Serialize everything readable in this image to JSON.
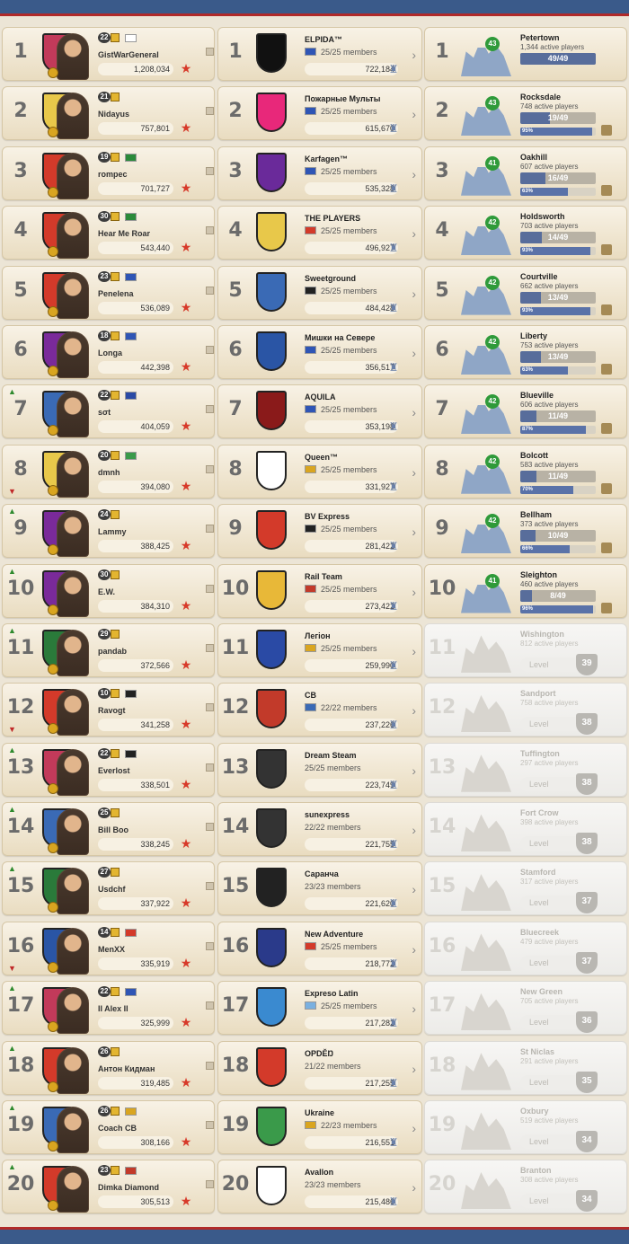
{
  "players": [
    {
      "rank": "1",
      "trend": "",
      "level": "22",
      "flag": "#ffffff",
      "name": "GistWarGeneral",
      "score": "1,208,034",
      "shield": "#c23a5a"
    },
    {
      "rank": "2",
      "trend": "",
      "level": "21",
      "flag": "",
      "name": "Nidayus",
      "score": "757,801",
      "shield": "#e8c84a"
    },
    {
      "rank": "3",
      "trend": "",
      "level": "19",
      "flag": "#2a8a3a",
      "name": "rompec",
      "score": "701,727",
      "shield": "#d33a2a"
    },
    {
      "rank": "4",
      "trend": "",
      "level": "30",
      "flag": "#2a8a3a",
      "name": "Hear Me Roar",
      "score": "543,440",
      "shield": "#d33a2a"
    },
    {
      "rank": "5",
      "trend": "",
      "level": "23",
      "flag": "#2f55b5",
      "name": "Penelena",
      "score": "536,089",
      "shield": "#d33a2a"
    },
    {
      "rank": "6",
      "trend": "",
      "level": "18",
      "flag": "#2f55b5",
      "name": "Longa",
      "score": "442,398",
      "shield": "#7a2a9a"
    },
    {
      "rank": "7",
      "trend": "up",
      "level": "22",
      "flag": "#2a4aa5",
      "name": "sσt",
      "score": "404,059",
      "shield": "#3a6ab5"
    },
    {
      "rank": "8",
      "trend": "down",
      "level": "20",
      "flag": "#3a9a4a",
      "name": "dmnh",
      "score": "394,080",
      "shield": "#e8c84a"
    },
    {
      "rank": "9",
      "trend": "up",
      "level": "24",
      "flag": "",
      "name": "Lammy",
      "score": "388,425",
      "shield": "#7a2a9a"
    },
    {
      "rank": "10",
      "trend": "up",
      "level": "30",
      "flag": "",
      "name": "E.W.",
      "score": "384,310",
      "shield": "#7a2a9a"
    },
    {
      "rank": "11",
      "trend": "up",
      "level": "29",
      "flag": "",
      "name": "pandab",
      "score": "372,566",
      "shield": "#2a7a3a"
    },
    {
      "rank": "12",
      "trend": "down",
      "level": "10",
      "flag": "#222222",
      "name": "Ravogt",
      "score": "341,258",
      "shield": "#d33a2a"
    },
    {
      "rank": "13",
      "trend": "up",
      "level": "22",
      "flag": "#222222",
      "name": "Everlost",
      "score": "338,501",
      "shield": "#c23a5a"
    },
    {
      "rank": "14",
      "trend": "up",
      "level": "25",
      "flag": "",
      "name": "Bill Boo",
      "score": "338,245",
      "shield": "#3a6ab5"
    },
    {
      "rank": "15",
      "trend": "up",
      "level": "27",
      "flag": "",
      "name": "Usdchf",
      "score": "337,922",
      "shield": "#2a7a3a"
    },
    {
      "rank": "16",
      "trend": "down",
      "level": "14",
      "flag": "#d33a2a",
      "name": "MenXX",
      "score": "335,919",
      "shield": "#2a55a5"
    },
    {
      "rank": "17",
      "trend": "up",
      "level": "22",
      "flag": "#2f55b5",
      "name": "II Alex II",
      "score": "325,999",
      "shield": "#c23a5a"
    },
    {
      "rank": "18",
      "trend": "up",
      "level": "26",
      "flag": "",
      "name": "Антон Кидман",
      "score": "319,485",
      "shield": "#d33a2a"
    },
    {
      "rank": "19",
      "trend": "up",
      "level": "26",
      "flag": "#d9a520",
      "name": "Coach CB",
      "score": "308,166",
      "shield": "#3a6ab5"
    },
    {
      "rank": "20",
      "trend": "up",
      "level": "23",
      "flag": "#c23a2a",
      "name": "Dimka Diamond",
      "score": "305,513",
      "shield": "#d33a2a"
    }
  ],
  "guilds": [
    {
      "rank": "1",
      "name": "ELPIDA™",
      "flag": "#2f55b5",
      "members": "25/25 members",
      "score": "722,184",
      "color": "#111111"
    },
    {
      "rank": "2",
      "name": "Пожарные Мульты",
      "flag": "#2f55b5",
      "members": "25/25 members",
      "score": "615,670",
      "color": "#e8287a"
    },
    {
      "rank": "3",
      "name": "Karfagen™",
      "flag": "#2f55b5",
      "members": "25/25 members",
      "score": "535,328",
      "color": "#6a2a9a"
    },
    {
      "rank": "4",
      "name": "THE PLAYERS",
      "flag": "#d33a2a",
      "members": "25/25 members",
      "score": "496,927",
      "color": "#e8c84a"
    },
    {
      "rank": "5",
      "name": "Sweetground",
      "flag": "#222222",
      "members": "25/25 members",
      "score": "484,428",
      "color": "#3a6ab5"
    },
    {
      "rank": "6",
      "name": "Мишки на Севере",
      "flag": "#2f55b5",
      "members": "25/25 members",
      "score": "356,517",
      "color": "#2a55a5"
    },
    {
      "rank": "7",
      "name": "AQUILA",
      "flag": "#2f55b5",
      "members": "25/25 members",
      "score": "353,198",
      "color": "#8a1a1a"
    },
    {
      "rank": "8",
      "name": "Queen™",
      "flag": "#d9a520",
      "members": "25/25 members",
      "score": "331,927",
      "color": "#ffffff"
    },
    {
      "rank": "9",
      "name": "BV Express",
      "flag": "#222222",
      "members": "25/25 members",
      "score": "281,422",
      "color": "#d33a2a"
    },
    {
      "rank": "10",
      "name": "Rail Team",
      "flag": "#c23a2a",
      "members": "25/25 members",
      "score": "273,422",
      "color": "#e8b838"
    },
    {
      "rank": "11",
      "name": "Легіон",
      "flag": "#d9a520",
      "members": "25/25 members",
      "score": "259,990",
      "color": "#2a4aa5"
    },
    {
      "rank": "12",
      "name": "CB",
      "flag": "#3a6ab5",
      "members": "22/22 members",
      "score": "237,226",
      "color": "#c23a2a"
    },
    {
      "rank": "13",
      "name": "Dream Steam",
      "flag": "",
      "members": "25/25 members",
      "score": "223,749",
      "color": "#333333"
    },
    {
      "rank": "14",
      "name": "sunexpress",
      "flag": "",
      "members": "22/22 members",
      "score": "221,755",
      "color": "#333333"
    },
    {
      "rank": "15",
      "name": "Саранча",
      "flag": "",
      "members": "23/23 members",
      "score": "221,620",
      "color": "#222222"
    },
    {
      "rank": "16",
      "name": "New Adventure",
      "flag": "#d33a2a",
      "members": "25/25 members",
      "score": "218,772",
      "color": "#2a3a8a"
    },
    {
      "rank": "17",
      "name": "Expreso Latin",
      "flag": "#7ab0e0",
      "members": "25/25 members",
      "score": "217,282",
      "color": "#3a8ad0"
    },
    {
      "rank": "18",
      "name": "ОРDĚŊ",
      "flag": "",
      "members": "21/22 members",
      "score": "217,255",
      "color": "#d33a2a"
    },
    {
      "rank": "19",
      "name": "Ukraine",
      "flag": "#d9a520",
      "members": "22/23 members",
      "score": "216,551",
      "color": "#3a9a4a"
    },
    {
      "rank": "20",
      "name": "Avallon",
      "flag": "",
      "members": "23/23 members",
      "score": "215,486",
      "color": "#ffffff"
    }
  ],
  "cities": [
    {
      "rank": "1",
      "name": "Petertown",
      "players": "1,344 active players",
      "level": "43",
      "progress": "49/49",
      "progress_value": 1.0,
      "stat": "",
      "stat_value": 0,
      "locked": false
    },
    {
      "rank": "2",
      "name": "Rocksdale",
      "players": "748 active players",
      "level": "43",
      "progress": "19/49",
      "progress_value": 0.39,
      "stat": "95%",
      "stat_value": 0.95,
      "locked": false
    },
    {
      "rank": "3",
      "name": "Oakhill",
      "players": "607 active players",
      "level": "41",
      "progress": "16/49",
      "progress_value": 0.33,
      "stat": "63%",
      "stat_value": 0.63,
      "locked": false
    },
    {
      "rank": "4",
      "name": "Holdsworth",
      "players": "703 active players",
      "level": "42",
      "progress": "14/49",
      "progress_value": 0.29,
      "stat": "93%",
      "stat_value": 0.93,
      "locked": false
    },
    {
      "rank": "5",
      "name": "Courtville",
      "players": "662 active players",
      "level": "42",
      "progress": "13/49",
      "progress_value": 0.27,
      "stat": "93%",
      "stat_value": 0.93,
      "locked": false
    },
    {
      "rank": "6",
      "name": "Liberty",
      "players": "753 active players",
      "level": "42",
      "progress": "13/49",
      "progress_value": 0.27,
      "stat": "63%",
      "stat_value": 0.63,
      "locked": false
    },
    {
      "rank": "7",
      "name": "Blueville",
      "players": "606 active players",
      "level": "42",
      "progress": "11/49",
      "progress_value": 0.22,
      "stat": "87%",
      "stat_value": 0.87,
      "locked": false
    },
    {
      "rank": "8",
      "name": "Bolcott",
      "players": "583 active players",
      "level": "42",
      "progress": "11/49",
      "progress_value": 0.22,
      "stat": "70%",
      "stat_value": 0.7,
      "locked": false
    },
    {
      "rank": "9",
      "name": "Bellham",
      "players": "373 active players",
      "level": "42",
      "progress": "10/49",
      "progress_value": 0.2,
      "stat": "66%",
      "stat_value": 0.66,
      "locked": false
    },
    {
      "rank": "10",
      "name": "Sleighton",
      "players": "460 active players",
      "level": "41",
      "progress": "8/49",
      "progress_value": 0.16,
      "stat": "96%",
      "stat_value": 0.96,
      "locked": false
    },
    {
      "rank": "11",
      "name": "Wishington",
      "players": "812 active players",
      "level": "39",
      "locked": true
    },
    {
      "rank": "12",
      "name": "Sandport",
      "players": "758 active players",
      "level": "38",
      "locked": true
    },
    {
      "rank": "13",
      "name": "Tuffington",
      "players": "297 active players",
      "level": "38",
      "locked": true
    },
    {
      "rank": "14",
      "name": "Fort Crow",
      "players": "398 active players",
      "level": "38",
      "locked": true
    },
    {
      "rank": "15",
      "name": "Stamford",
      "players": "317 active players",
      "level": "37",
      "locked": true
    },
    {
      "rank": "16",
      "name": "Bluecreek",
      "players": "479 active players",
      "level": "37",
      "locked": true
    },
    {
      "rank": "17",
      "name": "New Green",
      "players": "705 active players",
      "level": "36",
      "locked": true
    },
    {
      "rank": "18",
      "name": "St Niclas",
      "players": "291 active players",
      "level": "35",
      "locked": true
    },
    {
      "rank": "19",
      "name": "Oxbury",
      "players": "519 active players",
      "level": "34",
      "locked": true
    },
    {
      "rank": "20",
      "name": "Branton",
      "players": "308 active players",
      "level": "34",
      "locked": true
    }
  ],
  "labels": {
    "level": "Level"
  }
}
